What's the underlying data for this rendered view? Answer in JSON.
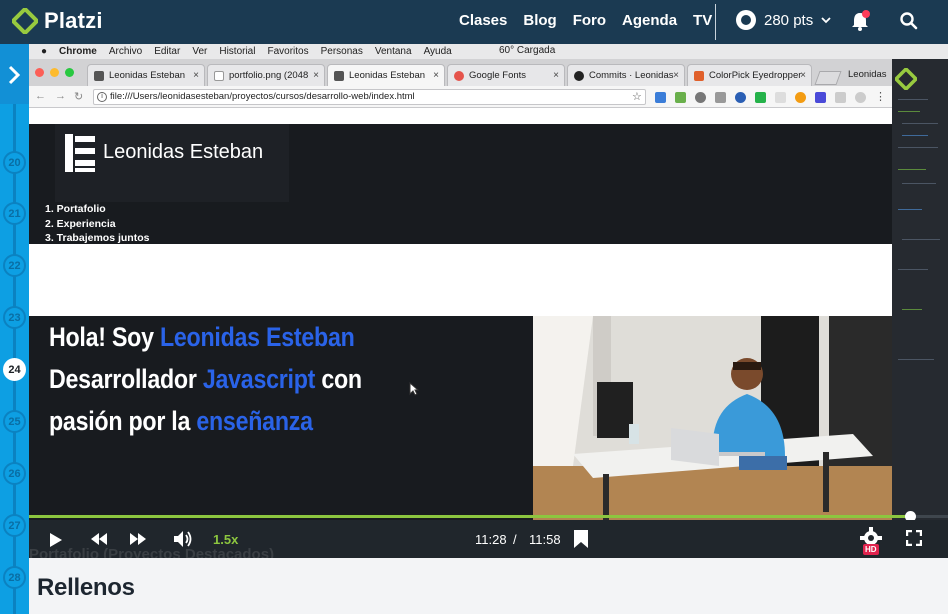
{
  "platzi": {
    "logo_text": "Platzi",
    "nav": [
      "Clases",
      "Blog",
      "Foro",
      "Agenda",
      "TV"
    ],
    "points": "280 pts"
  },
  "rail": {
    "numbers": [
      "20",
      "21",
      "22",
      "23",
      "24",
      "25",
      "26",
      "27",
      "28"
    ],
    "active": "24"
  },
  "mac_menu": [
    "Chrome",
    "Archivo",
    "Editar",
    "Ver",
    "Historial",
    "Favoritos",
    "Personas",
    "Ventana",
    "Ayuda"
  ],
  "mac_status": "60° Cargada",
  "browser": {
    "tabs": [
      {
        "label": "Leonidas Esteban",
        "color": "#555555"
      },
      {
        "label": "portfolio.png (2048",
        "color": "#999999"
      },
      {
        "label": "Leonidas Esteban",
        "color": "#555555"
      },
      {
        "label": "Google Fonts",
        "color": "#e5534b"
      },
      {
        "label": "Commits · Leonidas",
        "color": "#222222"
      },
      {
        "label": "ColorPick Eyedropper",
        "color": "#e0602b"
      }
    ],
    "profile": "Leonidas",
    "url": "file:///Users/leonidasesteban/proyectos/cursos/desarrollo-web/index.html"
  },
  "site": {
    "brand": "Leonidas Esteban",
    "menu": [
      "1. Portafolio",
      "2. Experiencia",
      "3. Trabajemos juntos"
    ],
    "hero": {
      "line1_pre": "Hola! Soy ",
      "line1_hl": "Leonidas Esteban",
      "line2_pre": "Desarrollador ",
      "line2_hl": "Javascript",
      "line2_post": " con",
      "line3_pre": "pasión por la ",
      "line3_hl": "enseñanza"
    },
    "ghost_section": "Portafolio (Proyectos Destacados)"
  },
  "player": {
    "speed": "1.5x",
    "current_time": "11:28",
    "separator": "/",
    "duration": "11:58",
    "progress": 0.959,
    "quality": "HD"
  },
  "lesson": {
    "title": "Rellenos"
  },
  "colors": {
    "platzi_navy": "#1b3a52",
    "platzi_green": "#8cc63f",
    "rail_blue": "#0d9fe3",
    "highlight_blue": "#2a63e8"
  }
}
